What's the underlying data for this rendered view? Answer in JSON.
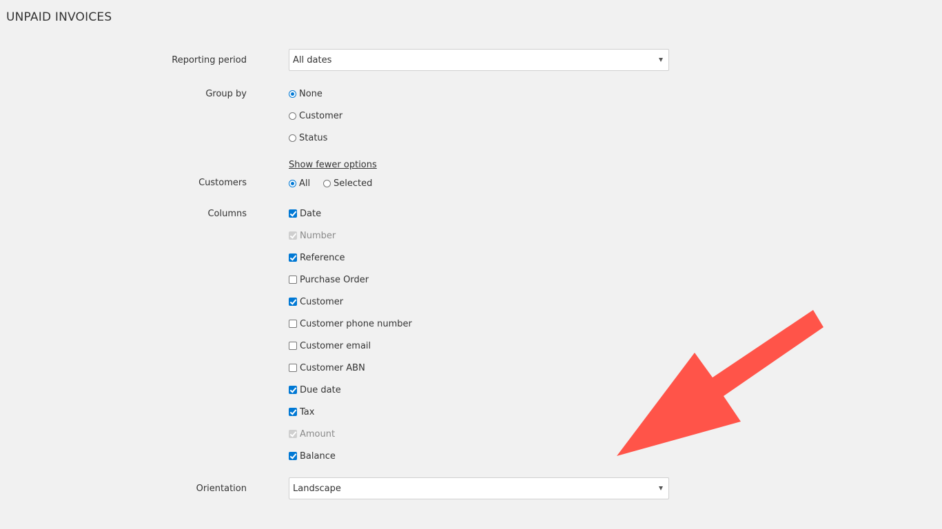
{
  "page": {
    "title": "UNPAID INVOICES"
  },
  "form": {
    "reporting_period": {
      "label": "Reporting period",
      "value": "All dates"
    },
    "group_by": {
      "label": "Group by",
      "options": [
        "None",
        "Customer",
        "Status"
      ],
      "selected": "None"
    },
    "toggle_options_link": "Show fewer options",
    "customers": {
      "label": "Customers",
      "options": [
        "All",
        "Selected"
      ],
      "selected": "All"
    },
    "columns": {
      "label": "Columns",
      "items": [
        {
          "label": "Date",
          "state": "checked"
        },
        {
          "label": "Number",
          "state": "disabled-checked"
        },
        {
          "label": "Reference",
          "state": "checked"
        },
        {
          "label": "Purchase Order",
          "state": "unchecked"
        },
        {
          "label": "Customer",
          "state": "checked"
        },
        {
          "label": "Customer phone number",
          "state": "unchecked"
        },
        {
          "label": "Customer email",
          "state": "unchecked"
        },
        {
          "label": "Customer ABN",
          "state": "unchecked"
        },
        {
          "label": "Due date",
          "state": "checked"
        },
        {
          "label": "Tax",
          "state": "checked"
        },
        {
          "label": "Amount",
          "state": "disabled-checked"
        },
        {
          "label": "Balance",
          "state": "checked"
        }
      ]
    },
    "orientation": {
      "label": "Orientation",
      "value": "Landscape"
    }
  },
  "colors": {
    "accent": "#0078d4",
    "background": "#f1f1f1",
    "annotation_arrow": "#ff5449"
  },
  "icons": {
    "select_caret": "chevron-down-icon",
    "annotation": "arrow-icon"
  }
}
